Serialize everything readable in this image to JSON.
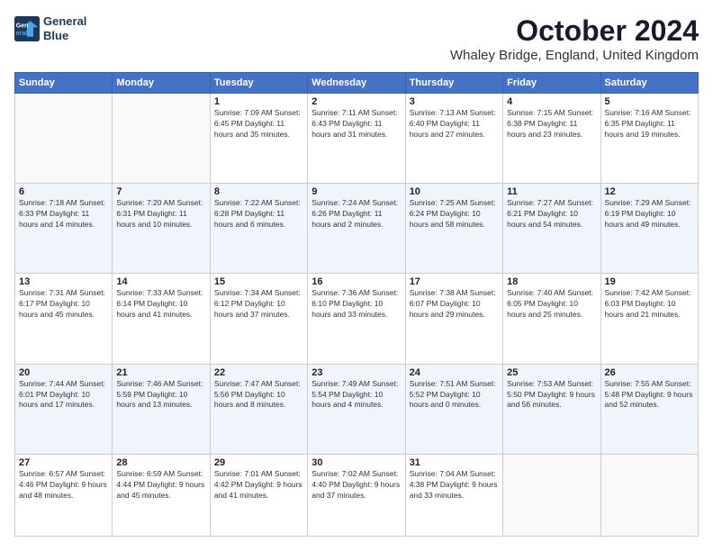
{
  "header": {
    "logo": {
      "line1": "General",
      "line2": "Blue"
    },
    "month": "October 2024",
    "location": "Whaley Bridge, England, United Kingdom"
  },
  "days_of_week": [
    "Sunday",
    "Monday",
    "Tuesday",
    "Wednesday",
    "Thursday",
    "Friday",
    "Saturday"
  ],
  "weeks": [
    [
      {
        "day": "",
        "info": ""
      },
      {
        "day": "",
        "info": ""
      },
      {
        "day": "1",
        "info": "Sunrise: 7:09 AM\nSunset: 6:45 PM\nDaylight: 11 hours and 35 minutes."
      },
      {
        "day": "2",
        "info": "Sunrise: 7:11 AM\nSunset: 6:43 PM\nDaylight: 11 hours and 31 minutes."
      },
      {
        "day": "3",
        "info": "Sunrise: 7:13 AM\nSunset: 6:40 PM\nDaylight: 11 hours and 27 minutes."
      },
      {
        "day": "4",
        "info": "Sunrise: 7:15 AM\nSunset: 6:38 PM\nDaylight: 11 hours and 23 minutes."
      },
      {
        "day": "5",
        "info": "Sunrise: 7:16 AM\nSunset: 6:35 PM\nDaylight: 11 hours and 19 minutes."
      }
    ],
    [
      {
        "day": "6",
        "info": "Sunrise: 7:18 AM\nSunset: 6:33 PM\nDaylight: 11 hours and 14 minutes."
      },
      {
        "day": "7",
        "info": "Sunrise: 7:20 AM\nSunset: 6:31 PM\nDaylight: 11 hours and 10 minutes."
      },
      {
        "day": "8",
        "info": "Sunrise: 7:22 AM\nSunset: 6:28 PM\nDaylight: 11 hours and 6 minutes."
      },
      {
        "day": "9",
        "info": "Sunrise: 7:24 AM\nSunset: 6:26 PM\nDaylight: 11 hours and 2 minutes."
      },
      {
        "day": "10",
        "info": "Sunrise: 7:25 AM\nSunset: 6:24 PM\nDaylight: 10 hours and 58 minutes."
      },
      {
        "day": "11",
        "info": "Sunrise: 7:27 AM\nSunset: 6:21 PM\nDaylight: 10 hours and 54 minutes."
      },
      {
        "day": "12",
        "info": "Sunrise: 7:29 AM\nSunset: 6:19 PM\nDaylight: 10 hours and 49 minutes."
      }
    ],
    [
      {
        "day": "13",
        "info": "Sunrise: 7:31 AM\nSunset: 6:17 PM\nDaylight: 10 hours and 45 minutes."
      },
      {
        "day": "14",
        "info": "Sunrise: 7:33 AM\nSunset: 6:14 PM\nDaylight: 10 hours and 41 minutes."
      },
      {
        "day": "15",
        "info": "Sunrise: 7:34 AM\nSunset: 6:12 PM\nDaylight: 10 hours and 37 minutes."
      },
      {
        "day": "16",
        "info": "Sunrise: 7:36 AM\nSunset: 6:10 PM\nDaylight: 10 hours and 33 minutes."
      },
      {
        "day": "17",
        "info": "Sunrise: 7:38 AM\nSunset: 6:07 PM\nDaylight: 10 hours and 29 minutes."
      },
      {
        "day": "18",
        "info": "Sunrise: 7:40 AM\nSunset: 6:05 PM\nDaylight: 10 hours and 25 minutes."
      },
      {
        "day": "19",
        "info": "Sunrise: 7:42 AM\nSunset: 6:03 PM\nDaylight: 10 hours and 21 minutes."
      }
    ],
    [
      {
        "day": "20",
        "info": "Sunrise: 7:44 AM\nSunset: 6:01 PM\nDaylight: 10 hours and 17 minutes."
      },
      {
        "day": "21",
        "info": "Sunrise: 7:46 AM\nSunset: 5:59 PM\nDaylight: 10 hours and 13 minutes."
      },
      {
        "day": "22",
        "info": "Sunrise: 7:47 AM\nSunset: 5:56 PM\nDaylight: 10 hours and 8 minutes."
      },
      {
        "day": "23",
        "info": "Sunrise: 7:49 AM\nSunset: 5:54 PM\nDaylight: 10 hours and 4 minutes."
      },
      {
        "day": "24",
        "info": "Sunrise: 7:51 AM\nSunset: 5:52 PM\nDaylight: 10 hours and 0 minutes."
      },
      {
        "day": "25",
        "info": "Sunrise: 7:53 AM\nSunset: 5:50 PM\nDaylight: 9 hours and 56 minutes."
      },
      {
        "day": "26",
        "info": "Sunrise: 7:55 AM\nSunset: 5:48 PM\nDaylight: 9 hours and 52 minutes."
      }
    ],
    [
      {
        "day": "27",
        "info": "Sunrise: 6:57 AM\nSunset: 4:46 PM\nDaylight: 9 hours and 48 minutes."
      },
      {
        "day": "28",
        "info": "Sunrise: 6:59 AM\nSunset: 4:44 PM\nDaylight: 9 hours and 45 minutes."
      },
      {
        "day": "29",
        "info": "Sunrise: 7:01 AM\nSunset: 4:42 PM\nDaylight: 9 hours and 41 minutes."
      },
      {
        "day": "30",
        "info": "Sunrise: 7:02 AM\nSunset: 4:40 PM\nDaylight: 9 hours and 37 minutes."
      },
      {
        "day": "31",
        "info": "Sunrise: 7:04 AM\nSunset: 4:38 PM\nDaylight: 9 hours and 33 minutes."
      },
      {
        "day": "",
        "info": ""
      },
      {
        "day": "",
        "info": ""
      }
    ]
  ]
}
